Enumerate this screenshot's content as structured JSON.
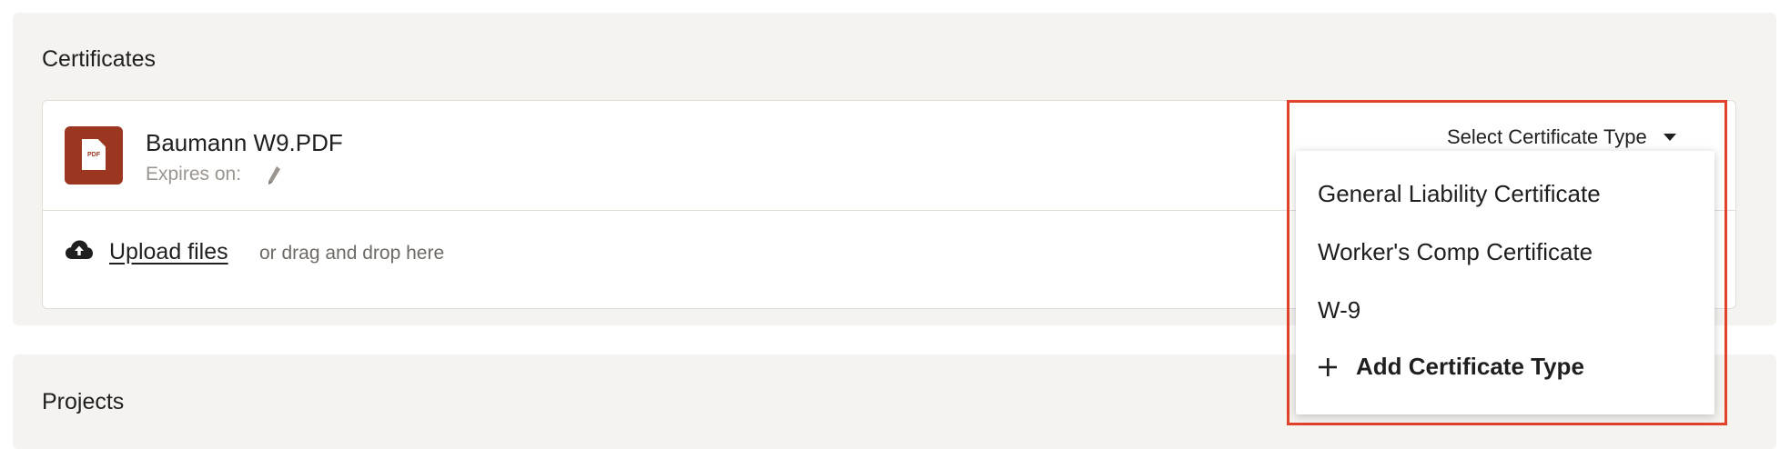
{
  "certificates": {
    "title": "Certificates",
    "file": {
      "icon": "pdf-file-icon",
      "icon_text": "PDF",
      "name": "Baumann W9.PDF",
      "expires_label": "Expires on:",
      "edit_icon": "pencil-icon"
    },
    "upload": {
      "icon": "cloud-upload-icon",
      "link_label": "Upload files",
      "hint": "or drag and drop here"
    },
    "certificate_type_select": {
      "placeholder": "Select Certificate Type",
      "icon": "chevron-down-icon",
      "options": [
        "General Liability Certificate",
        "Worker's Comp Certificate",
        "W-9"
      ],
      "add_option_label": "Add Certificate Type",
      "add_icon": "plus-icon"
    }
  },
  "projects": {
    "title": "Projects"
  },
  "colors": {
    "panel_bg": "#f5f3f0",
    "file_icon_bg": "#9b3721",
    "highlight_border": "#e2412a"
  }
}
